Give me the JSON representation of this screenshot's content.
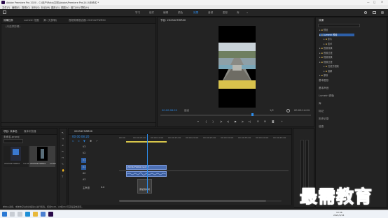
{
  "window": {
    "title": "Adobe Premiere Pro 2020 - C:\\用户\\Roto\\文档\\Adobe\\Premiere Pro\\14.0\\未命名 *"
  },
  "menu": [
    "文件(F)",
    "编辑(E)",
    "剪辑(C)",
    "序列(S)",
    "标记(M)",
    "图形(G)",
    "视图(V)",
    "窗口(W)",
    "帮助(H)"
  ],
  "workspaces": [
    "学习",
    "组件",
    "编辑",
    "颜色",
    "效果",
    "音频",
    "图形",
    "库",
    "»"
  ],
  "source_panel": {
    "tabs": [
      "效果控件",
      "Lumetri 范围",
      "源: (无剪辑)",
      "音频剪辑混合器: 2023427WRS0"
    ],
    "no_clip_text": "(未选择剪辑)"
  },
  "program_panel": {
    "title": "节目: 2023427WRS0",
    "timecode_current": "00:00:08:20",
    "fit_label": "适合",
    "quality_label": "1/2",
    "timecode_duration": "00:00:14:04"
  },
  "project_panel": {
    "tabs": [
      "项目: 未命名",
      "媒体浏览器"
    ],
    "path": "未命名.prproj",
    "items": [
      {
        "name": "2023427WRS0",
        "duration": "14:04"
      },
      {
        "name": "2023427WRS0",
        "duration": "14:04"
      }
    ]
  },
  "timeline": {
    "sequence_name": "2023427WRS0",
    "timecode": "00:00:08:20",
    "ruler": [
      "00:00",
      "00:00:05:00",
      "00:00:10:00",
      "00:00:15:00",
      "00:00:20:00",
      "00:00:25:00",
      "00:00:30:00",
      "00:00:35:00",
      "00:00:40:00",
      "00:00:45:00"
    ],
    "tracks": [
      "V3",
      "V2",
      "V1",
      "A1",
      "A2",
      "A3"
    ],
    "master_label": "主声道",
    "master_value": "0.0",
    "tooltip": "添加到时间",
    "clip_label": "2023427WRS0.mp4 [V]"
  },
  "effects_panel": {
    "title": "效果",
    "search_placeholder": "",
    "tree": [
      {
        "label": "预设",
        "depth": 0
      },
      {
        "label": "Lumetri 预设",
        "depth": 0,
        "highlight": true
      },
      {
        "label": "影片",
        "depth": 1
      },
      {
        "label": "技术",
        "depth": 1
      },
      {
        "label": "音频效果",
        "depth": 0
      },
      {
        "label": "音频过渡",
        "depth": 0
      },
      {
        "label": "视频效果",
        "depth": 0
      },
      {
        "label": "视频过渡",
        "depth": 0
      },
      {
        "label": "沉浸式视频",
        "depth": 1
      },
      {
        "label": "溶解",
        "depth": 1
      },
      {
        "label": "擦除",
        "depth": 0
      }
    ],
    "sections": [
      "基本图形",
      "基本声音",
      "Lumetri 颜色",
      "库",
      "标记",
      "历史记录",
      "信息"
    ]
  },
  "statusbar": {
    "text": "单击以选择，或单击空白处并拖动以进行框选。使用Shift、Alt和Ctrl可获得其他选项。"
  },
  "taskbar": {
    "time": "10:36",
    "date": "2021/5/24"
  },
  "watermark": "最需教育",
  "colors": {
    "accent": "#2d8ceb",
    "playhead": "#2d8ceb",
    "clip": "#4c6fb4",
    "workarea": "#d7c54a"
  }
}
